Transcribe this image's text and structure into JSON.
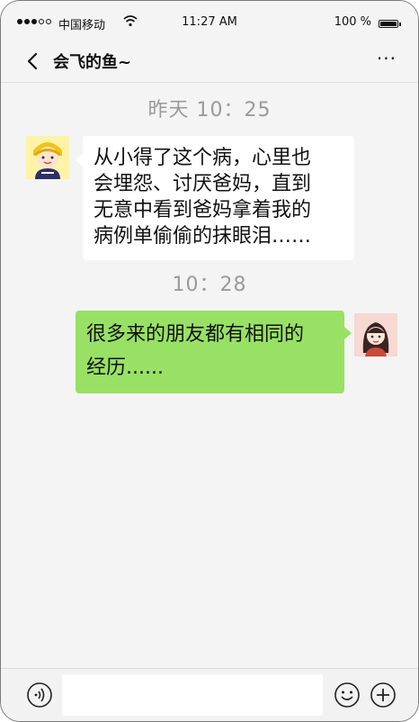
{
  "status_bar": {
    "carrier": "中国移动",
    "time": "11:27 AM",
    "battery": "100 %"
  },
  "nav": {
    "title": "会飞的鱼~",
    "back_icon": "chevron-left-icon",
    "more_icon": "more-icon"
  },
  "messages": {
    "timestamp_1": "昨天  10：25",
    "incoming": {
      "line_1": "从小得了这个病，心里也",
      "line_2": "会埋怨、讨厌爸妈，直到",
      "line_3": "无意中看到爸妈拿着我的",
      "line_4": "病例单偷偷的抹眼泪……"
    },
    "timestamp_2": "10：28",
    "outgoing": {
      "line_1": "很多来的朋友都有相同的",
      "line_2": "经历......"
    }
  },
  "input_bar": {
    "placeholder": "",
    "voice_icon": "voice-icon",
    "emoji_icon": "emoji-icon",
    "plus_icon": "plus-icon"
  },
  "colors": {
    "background": "#f4f4f4",
    "incoming_bubble": "#ffffff",
    "outgoing_bubble": "#98e165",
    "timestamp_text": "#9a9a9a"
  }
}
